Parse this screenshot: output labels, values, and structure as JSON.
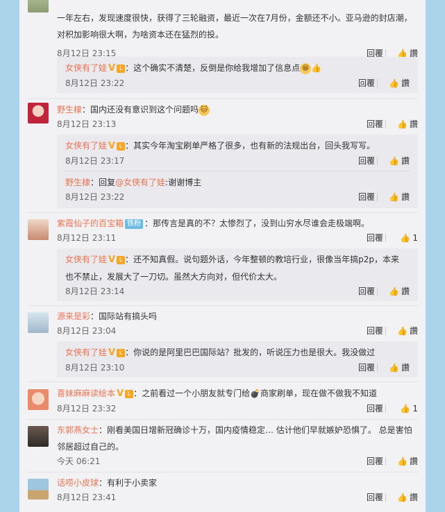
{
  "ui": {
    "reply_label": "回覆",
    "like_icon": "thumb-up-icon",
    "vip_icon": "vip-v-icon",
    "level_icon": "level-badge-icon"
  },
  "comments": [
    {
      "user": "",
      "text": "一年左右，发现速度很快，获得了三轮融资，最近一次在7月份，金额还不小。亚马逊的封店潮，",
      "text2": "对积加影响很大啊，为啥资本还在猛烈的投。",
      "time": "8月12日 23:15",
      "likes": "",
      "reply": {
        "user": "女侠有了娃",
        "text": "：这个确实不清楚，反倒是你给我增加了信息点",
        "time": "8月12日 23:22",
        "likes": ""
      }
    },
    {
      "user": "野生棣",
      "text": "：国内还没有意识到这个问题吗",
      "time": "8月12日 23:13",
      "likes": "",
      "replies": [
        {
          "user": "女侠有了娃",
          "text": "：其实今年淘宝刷单严格了很多，也有新的法规出台，回头我写写。",
          "time": "8月12日 23:17",
          "likes": ""
        },
        {
          "user": "野生棣",
          "text_pre": "：回复",
          "mention": "@女侠有了娃",
          "text": ":谢谢博主",
          "time": "8月12日 23:22",
          "likes": ""
        }
      ]
    },
    {
      "user": "紫霞仙子的百宝箱",
      "tag": "铁粉",
      "text": "：那传言是真的不？太惨烈了，没到山穷水尽谁会走极端啊。",
      "time": "8月12日 23:11",
      "likes": "1",
      "reply": {
        "user": "女侠有了娃",
        "text": "：还不知真假。说句题外话，今年整顿的教培行业，很像当年搞p2p，本来",
        "text2": "也不禁止，发展大了一刀切。虽然大方向对，但代价太大。",
        "time": "8月12日 23:14",
        "likes": ""
      }
    },
    {
      "user": "源来是彩",
      "text": "：国际站有搞头吗",
      "time": "8月12日 23:04",
      "likes": "",
      "reply": {
        "user": "女侠有了娃",
        "text": "：你说的是阿里巴巴国际站？批发的，听说压力也是很大。我没做过",
        "time": "8月12日 23:10",
        "likes": ""
      }
    },
    {
      "user": "喜妹麻麻读绘本",
      "text": "：之前看过一个小朋友就专门给",
      "text_b": "商家刷单，现在做不做我不知道",
      "time": "8月12日 23:32",
      "likes": "1"
    },
    {
      "user": "东郭燕女士",
      "text": "：刚看美国日增新冠确诊十万，国内疫情稳定… 估计他们早就嫉妒恐惧了。 总是害怕",
      "text2": "邻居超过自己的。",
      "time": "今天 06:21",
      "likes": ""
    },
    {
      "user": "话唠小皮球",
      "text": "：有利于小卖家",
      "time": "8月12日 23:41",
      "likes": ""
    }
  ]
}
